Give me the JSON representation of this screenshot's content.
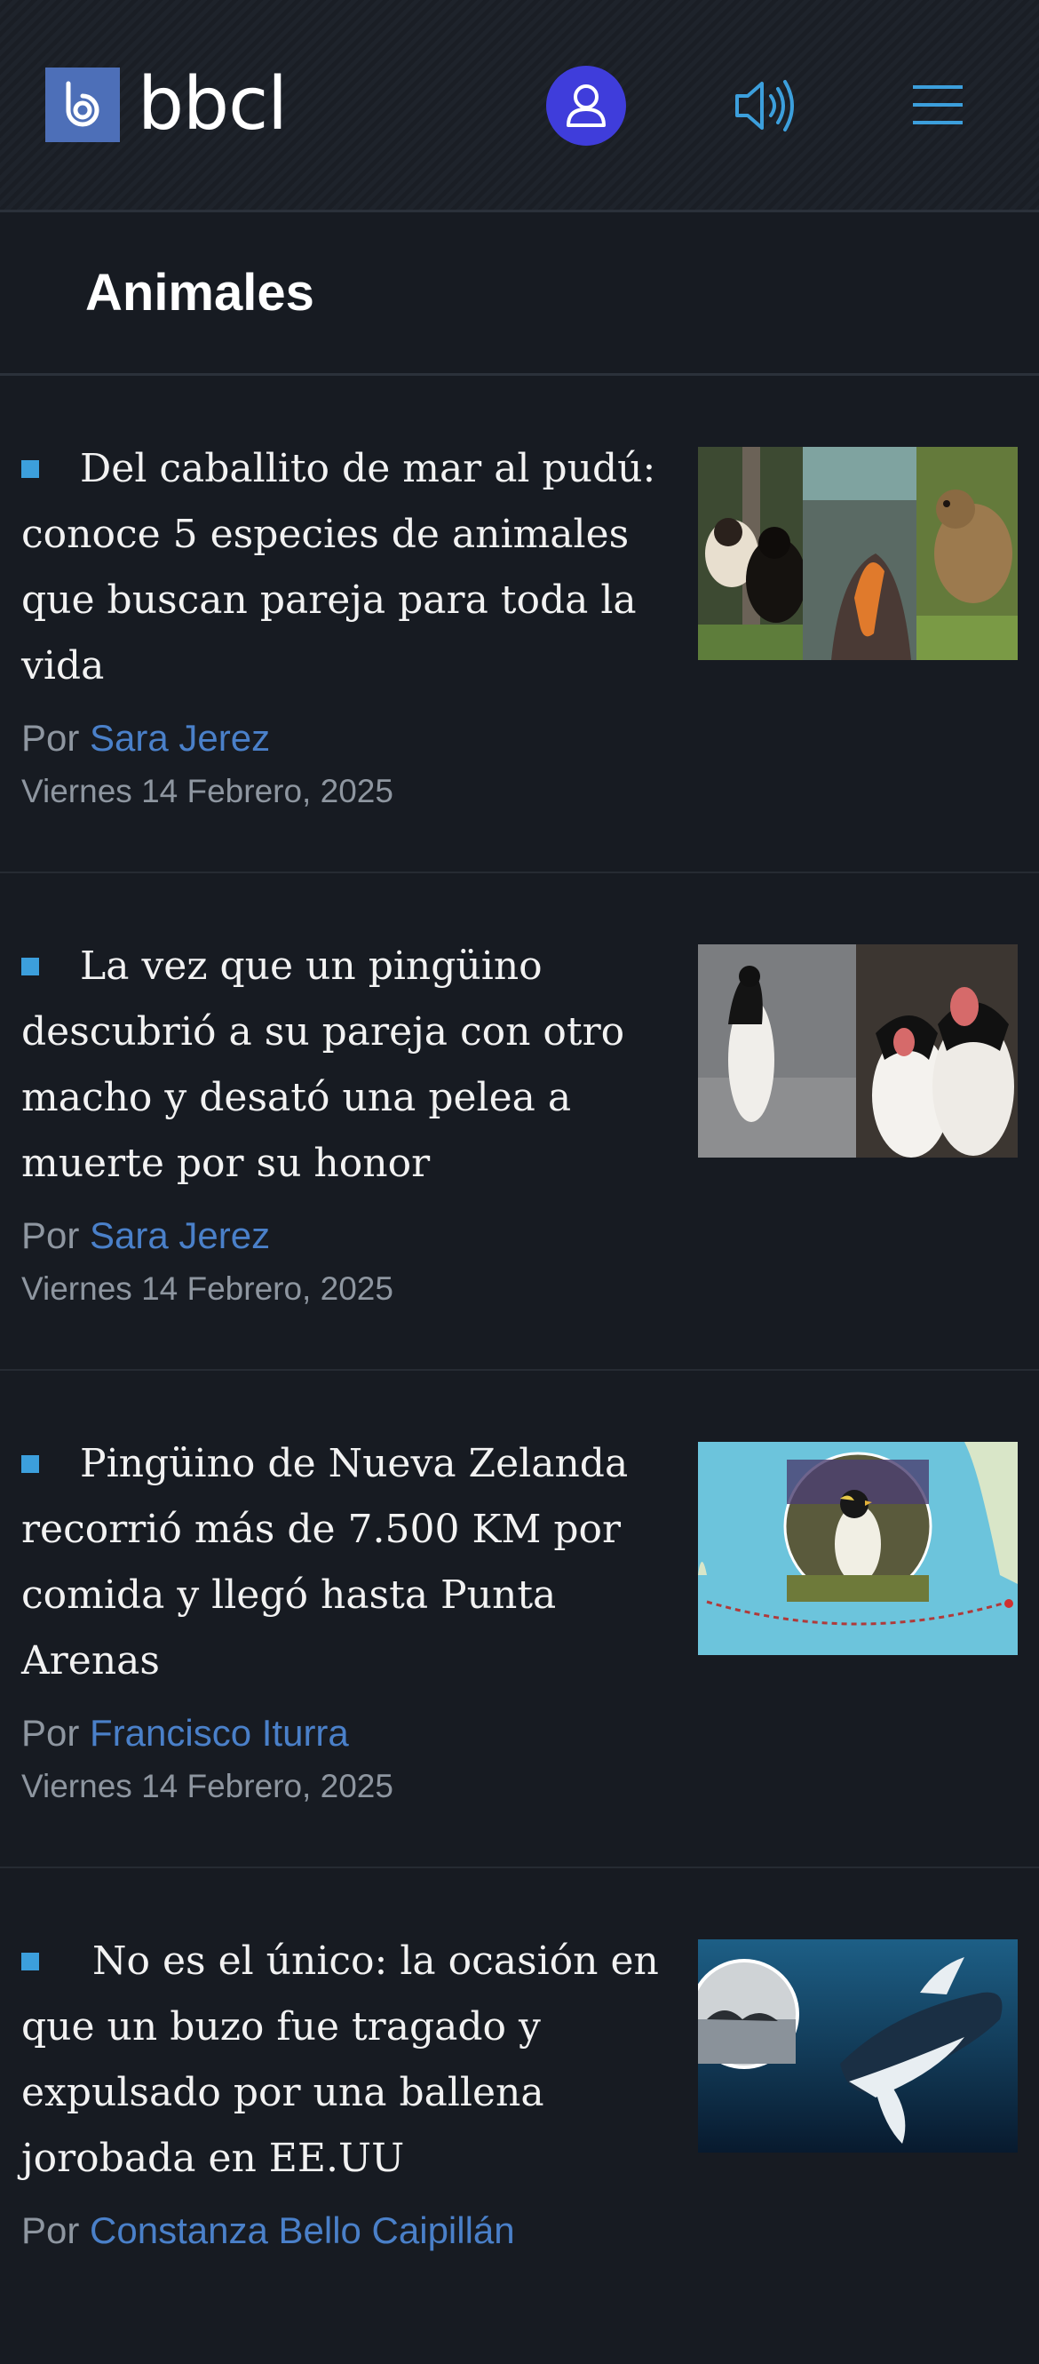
{
  "header": {
    "logo_text": "bbcl",
    "icons": {
      "user": "user-icon",
      "audio": "speaker-icon",
      "menu": "hamburger-menu-icon"
    },
    "colors": {
      "logo_mark": "#4d6fb8",
      "user_button": "#3f3ddb",
      "accent": "#3c9fdc"
    }
  },
  "section": {
    "title": "Animales"
  },
  "articles": [
    {
      "headline": "Del caballito de mar al pudú: conoce 5 especies de animales que buscan pareja para toda la vida",
      "by_prefix": "Por",
      "author": "Sara Jerez",
      "date": "Viernes 14 Febrero, 2025"
    },
    {
      "headline": "La vez que un pingüino descubrió a su pareja con otro macho y desató una pelea a muerte por su honor",
      "by_prefix": "Por",
      "author": "Sara Jerez",
      "date": "Viernes 14 Febrero, 2025"
    },
    {
      "headline": "Pingüino de Nueva Zelanda recorrió más de 7.500 KM por comida y llegó hasta Punta Arenas",
      "by_prefix": "Por",
      "author": "Francisco Iturra",
      "date": "Viernes 14 Febrero, 2025"
    },
    {
      "headline": " No es el único: la ocasión en que un buzo fue tragado y expulsado por una ballena jorobada en EE.UU",
      "by_prefix": "Por",
      "author": "Constanza Bello Caipillán",
      "date": ""
    }
  ]
}
